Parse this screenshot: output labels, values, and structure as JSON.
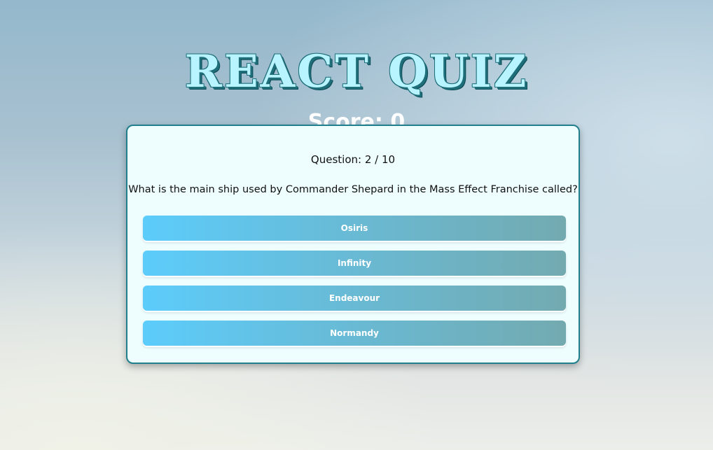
{
  "app": {
    "title": "REACT QUIZ"
  },
  "score": {
    "label": "Score: 0"
  },
  "quiz": {
    "question_number": "Question: 2 / 10",
    "question_text": "What is the main ship used by Commander Shepard in the Mass Effect Franchise called?",
    "answers": [
      {
        "label": "Osiris"
      },
      {
        "label": "Infinity"
      },
      {
        "label": "Endeavour"
      },
      {
        "label": "Normandy"
      }
    ]
  },
  "colors": {
    "card_background": "#eefeff",
    "card_border": "#1f7f8c",
    "answer_gradient_start": "#5cccfb",
    "answer_gradient_end": "#73aab0",
    "title_fill": "#b8f4ff",
    "title_outline": "#1f6f7a"
  }
}
